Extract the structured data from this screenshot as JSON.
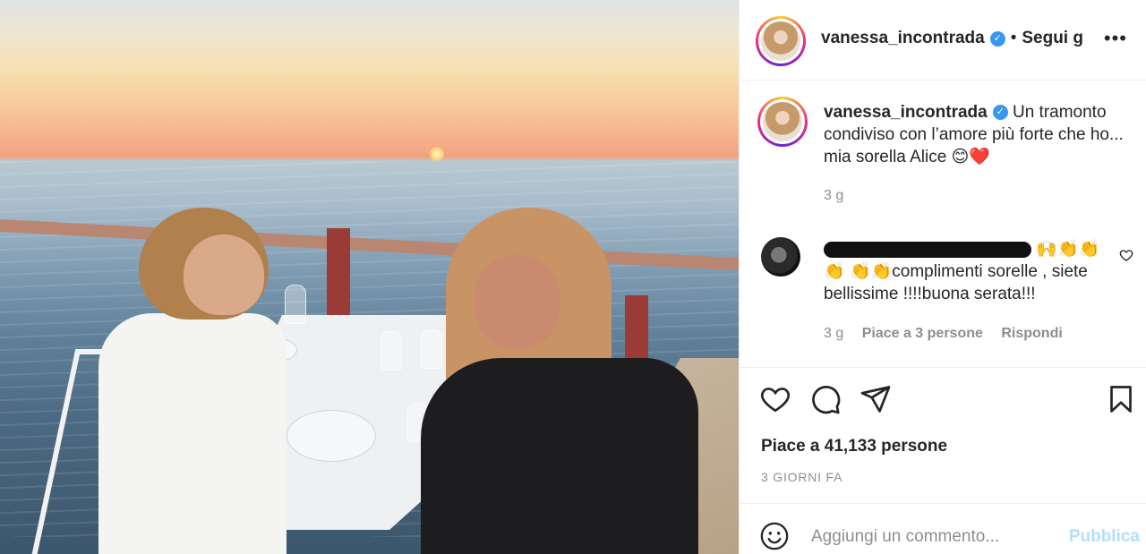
{
  "post": {
    "image_alt": "",
    "author": {
      "username": "vanessa_incontrada",
      "verified": true
    },
    "header": {
      "separator": "•",
      "follow_label": "Segui già",
      "more_icon": "more-horizontal-icon"
    },
    "caption": {
      "username": "vanessa_incontrada",
      "text": "Un tramonto condiviso con l’amore più forte che ho... mia sorella Alice 😊❤️",
      "time": "3 g"
    },
    "comments": [
      {
        "username_redacted": true,
        "text_emoji": "🙌👏👏👏",
        "text": "👏👏complimenti sorelle , siete bellissime !!!!buona serata!!!",
        "time": "3 g",
        "likes": "Piace a 3 persone",
        "reply_label": "Rispondi"
      }
    ],
    "actions": {
      "like_icon": "heart-icon",
      "comment_icon": "comment-icon",
      "share_icon": "send-icon",
      "save_icon": "bookmark-icon"
    },
    "likes_text": "Piace a 41,133 persone",
    "date_text": "3 GIORNI FA",
    "add_comment": {
      "emoji_icon": "smiley-icon",
      "placeholder": "Aggiungi un commento...",
      "publish_label": "Pubblica",
      "publish_color": "#b2dffc"
    }
  },
  "colors": {
    "text_primary": "#262626",
    "text_secondary": "#8e8e8e",
    "verified_blue": "#3897f0",
    "border": "#efefef"
  }
}
